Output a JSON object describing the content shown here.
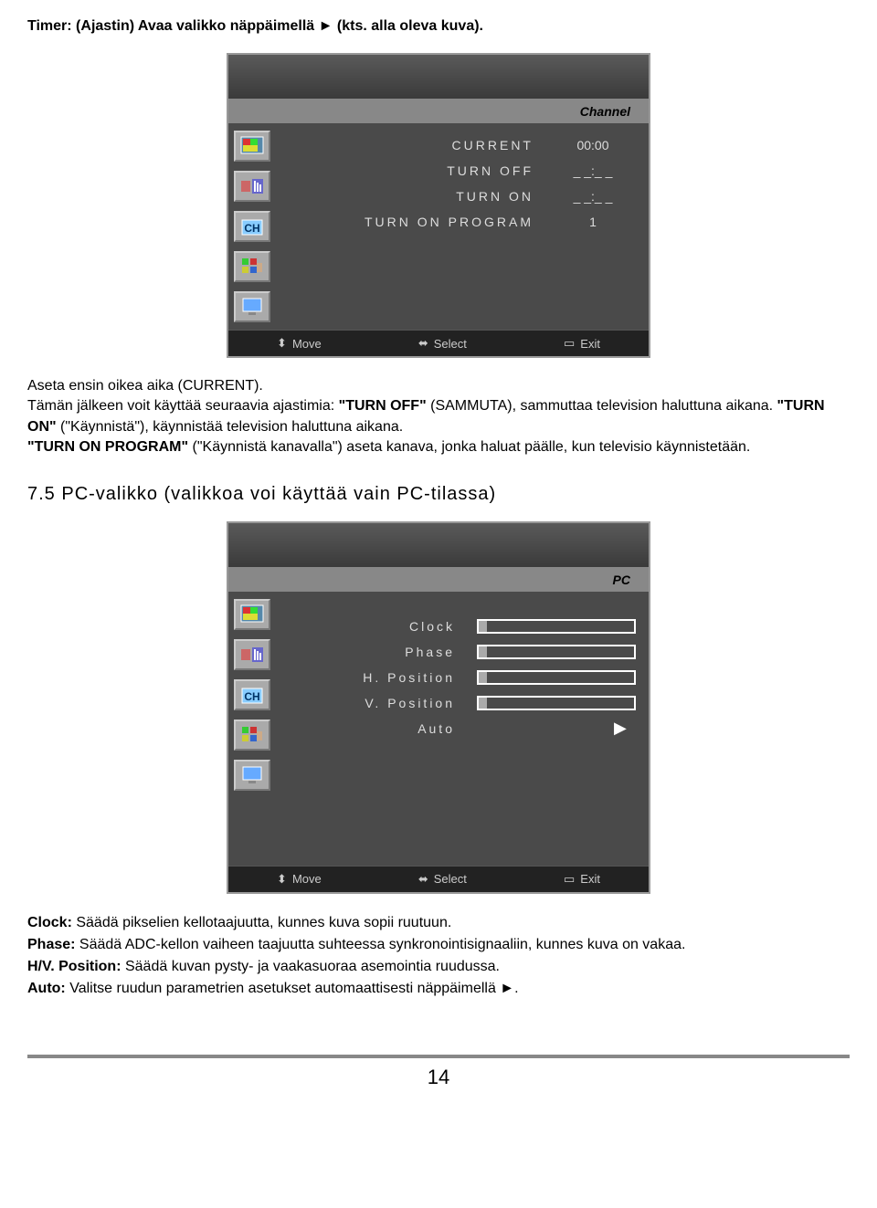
{
  "heading": {
    "label": "Timer",
    "text": ": (Ajastin) Avaa valikko näppäimellä ► (kts. alla oleva kuva)."
  },
  "panel1": {
    "title": "Channel",
    "rows": [
      {
        "label": "CURRENT",
        "value": "00:00"
      },
      {
        "label": "TURN OFF",
        "value": "_ _:_ _"
      },
      {
        "label": "TURN ON",
        "value": "_ _:_ _"
      },
      {
        "label": "TURN ON PROGRAM",
        "value": "1"
      }
    ],
    "footer": {
      "move": "Move",
      "select": "Select",
      "exit": "Exit"
    }
  },
  "para1_a": "Aseta ensin oikea aika (CURRENT).",
  "para1_b": "Tämän jälkeen voit käyttää seuraavia ajastimia: ",
  "para1_turnoff": "\"TURN OFF\"",
  "para1_c": " (SAMMUTA), sammuttaa television haluttuna aikana. ",
  "para1_turnon": "\"TURN ON\"",
  "para1_d": " (\"Käynnistä\"), käynnistää television haluttuna aikana.",
  "para1_top": "\"TURN ON PROGRAM\"",
  "para1_e": " (\"Käynnistä kanavalla\") aseta kanava, jonka haluat päälle, kun televisio käynnistetään.",
  "section_title": "7.5 PC-valikko (valikkoa voi käyttää vain PC-tilassa)",
  "panel2": {
    "title": "PC",
    "rows": [
      {
        "label": "Clock"
      },
      {
        "label": "Phase"
      },
      {
        "label": "H. Position"
      },
      {
        "label": "V. Position"
      },
      {
        "label": "Auto"
      }
    ],
    "footer": {
      "move": "Move",
      "select": "Select",
      "exit": "Exit"
    }
  },
  "defs": {
    "clock_t": "Clock:",
    "clock": " Säädä pikselien kellotaajuutta, kunnes kuva sopii ruutuun.",
    "phase_t": "Phase:",
    "phase": " Säädä ADC-kellon vaiheen taajuutta suhteessa synkronointisignaaliin, kunnes kuva on vakaa.",
    "hv_t": "H/V. Position:",
    "hv": " Säädä kuvan pysty- ja vaakasuoraa asemointia ruudussa.",
    "auto_t": "Auto:",
    "auto": " Valitse ruudun parametrien asetukset automaattisesti näppäimellä ►."
  },
  "page_num": "14"
}
